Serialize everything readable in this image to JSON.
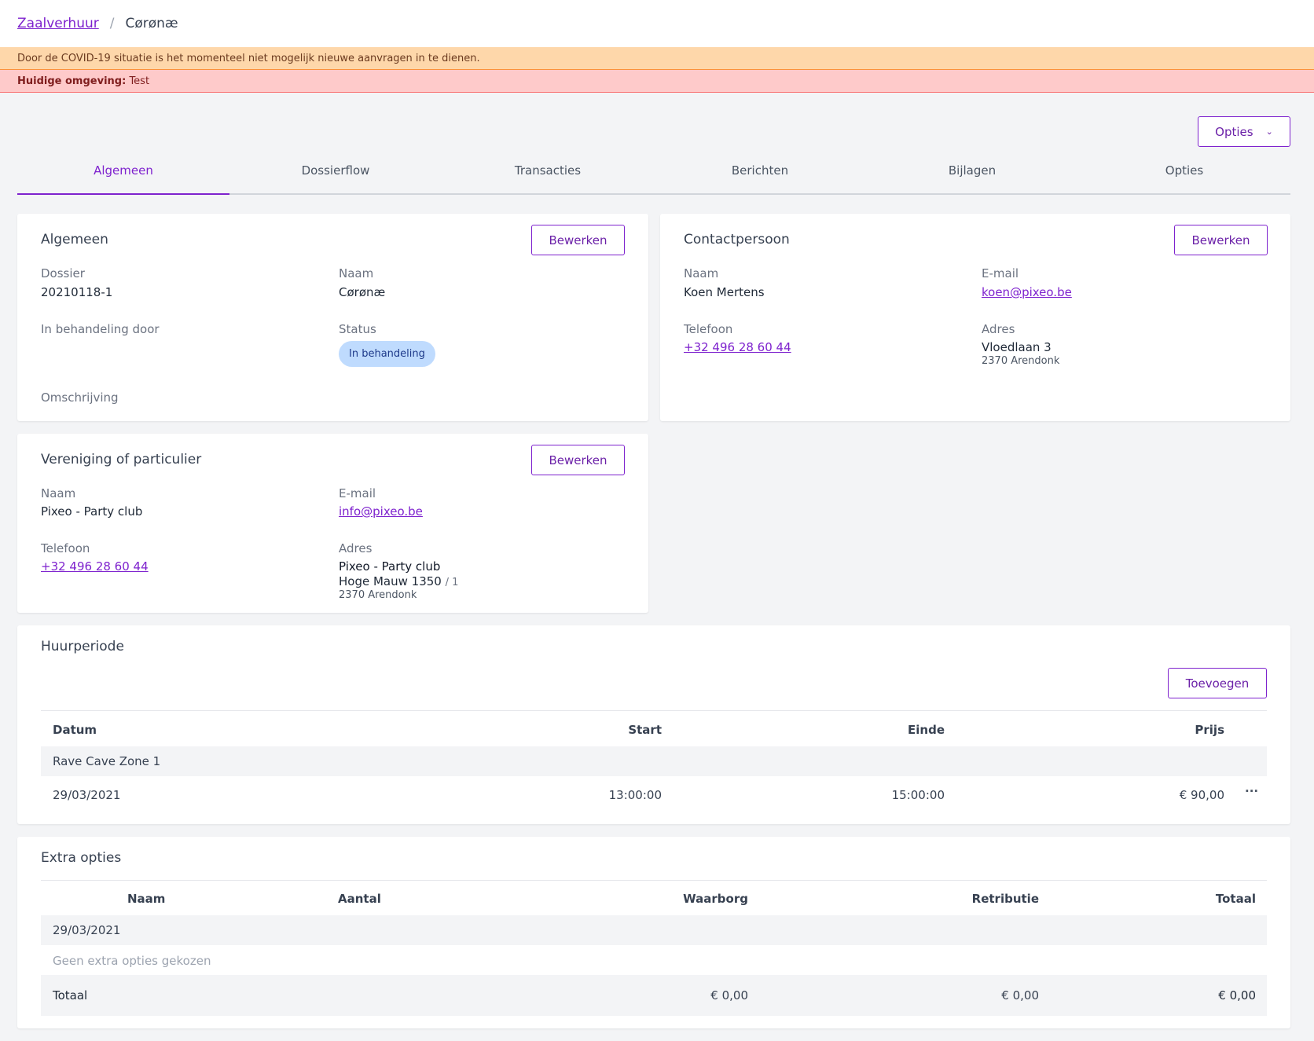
{
  "breadcrumb": {
    "parent": "Zaalverhuur",
    "separator": "/",
    "current": "Cørønæ"
  },
  "banners": {
    "warning": "Door de COVID-19 situatie is het momenteel niet mogelijk nieuwe aanvragen in te dienen.",
    "env_label": "Huidige omgeving:",
    "env_value": "Test"
  },
  "options_button": "Opties",
  "tabs": [
    "Algemeen",
    "Dossierflow",
    "Transacties",
    "Berichten",
    "Bijlagen",
    "Opties"
  ],
  "edit_label": "Bewerken",
  "general": {
    "title": "Algemeen",
    "dossier_label": "Dossier",
    "dossier_value": "20210118-1",
    "name_label": "Naam",
    "name_value": "Cørønæ",
    "handler_label": "In behandeling door",
    "status_label": "Status",
    "status_value": "In behandeling",
    "description_label": "Omschrijving"
  },
  "contact": {
    "title": "Contactpersoon",
    "name_label": "Naam",
    "name_value": "Koen Mertens",
    "email_label": "E-mail",
    "email_value": "koen@pixeo.be",
    "phone_label": "Telefoon",
    "phone_value": "+32 496 28 60 44",
    "address_label": "Adres",
    "address_line1": "Vloedlaan 3",
    "address_line2": "2370 Arendonk"
  },
  "organisation": {
    "title": "Vereniging of particulier",
    "name_label": "Naam",
    "name_value": "Pixeo - Party club",
    "email_label": "E-mail",
    "email_value": "info@pixeo.be",
    "phone_label": "Telefoon",
    "phone_value": "+32 496 28 60 44",
    "address_label": "Adres",
    "address_name": "Pixeo - Party club",
    "address_street": "Hoge Mauw 1350",
    "address_box": "/ 1",
    "address_city": "2370 Arendonk"
  },
  "rental": {
    "title": "Huurperiode",
    "add_label": "Toevoegen",
    "headers": {
      "date": "Datum",
      "start": "Start",
      "end": "Einde",
      "price": "Prijs"
    },
    "group": "Rave Cave Zone 1",
    "rows": [
      {
        "date": "29/03/2021",
        "start": "13:00:00",
        "end": "15:00:00",
        "price": "€ 90,00",
        "menu": "···"
      }
    ]
  },
  "extras": {
    "title": "Extra opties",
    "headers": {
      "name": "Naam",
      "qty": "Aantal",
      "deposit": "Waarborg",
      "fee": "Retributie",
      "total": "Totaal"
    },
    "group": "29/03/2021",
    "empty": "Geen extra opties gekozen",
    "totals": {
      "label": "Totaal",
      "deposit": "€ 0,00",
      "fee": "€ 0,00",
      "total": "€ 0,00"
    }
  }
}
